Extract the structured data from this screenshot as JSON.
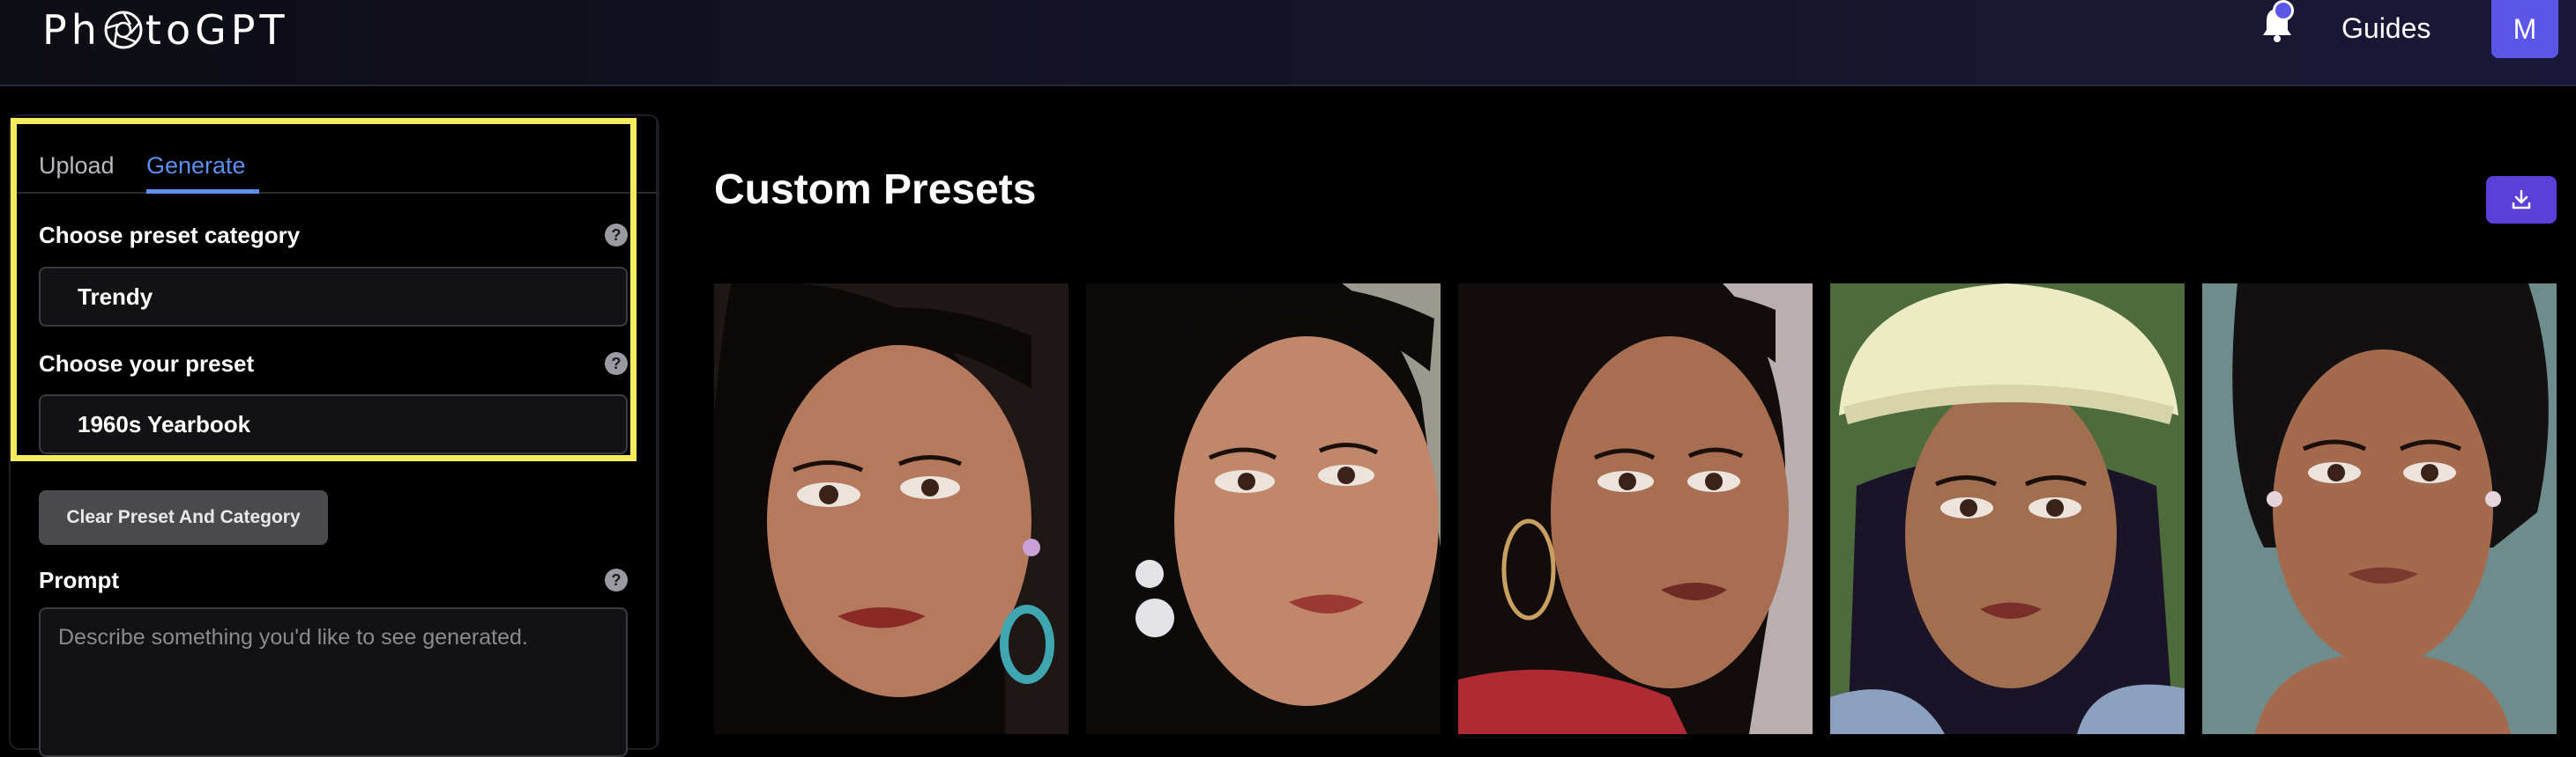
{
  "header": {
    "logo_text_before": "Ph",
    "logo_text_after": "toGPT",
    "logo_aperture_icon": "camera-aperture-icon",
    "notification_icon": "bell-icon",
    "guides_label": "Guides",
    "avatar_initial": "M",
    "accent": "#5b55e8"
  },
  "sidebar": {
    "tabs": [
      {
        "label": "Upload",
        "active": false
      },
      {
        "label": "Generate",
        "active": true
      }
    ],
    "preset_category": {
      "label": "Choose preset category",
      "help_icon": "question-mark-icon",
      "value": "Trendy"
    },
    "preset": {
      "label": "Choose your preset",
      "help_icon": "question-mark-icon",
      "value": "1960s Yearbook"
    },
    "clear_button_label": "Clear Preset And Category",
    "prompt": {
      "label": "Prompt",
      "help_icon": "question-mark-icon",
      "placeholder": "Describe something you'd like to see generated."
    },
    "highlight_color": "#f4ec5c"
  },
  "main": {
    "title": "Custom Presets",
    "download_icon": "download-icon",
    "gallery": [
      {
        "name": "preset-image-1",
        "bg": "#2a2220"
      },
      {
        "name": "preset-image-2",
        "bg": "#9a9a90"
      },
      {
        "name": "preset-image-3",
        "bg": "#b8aeb0"
      },
      {
        "name": "preset-image-4",
        "bg": "#4a6a3a"
      },
      {
        "name": "preset-image-5",
        "bg": "#6f8a8a"
      }
    ]
  }
}
